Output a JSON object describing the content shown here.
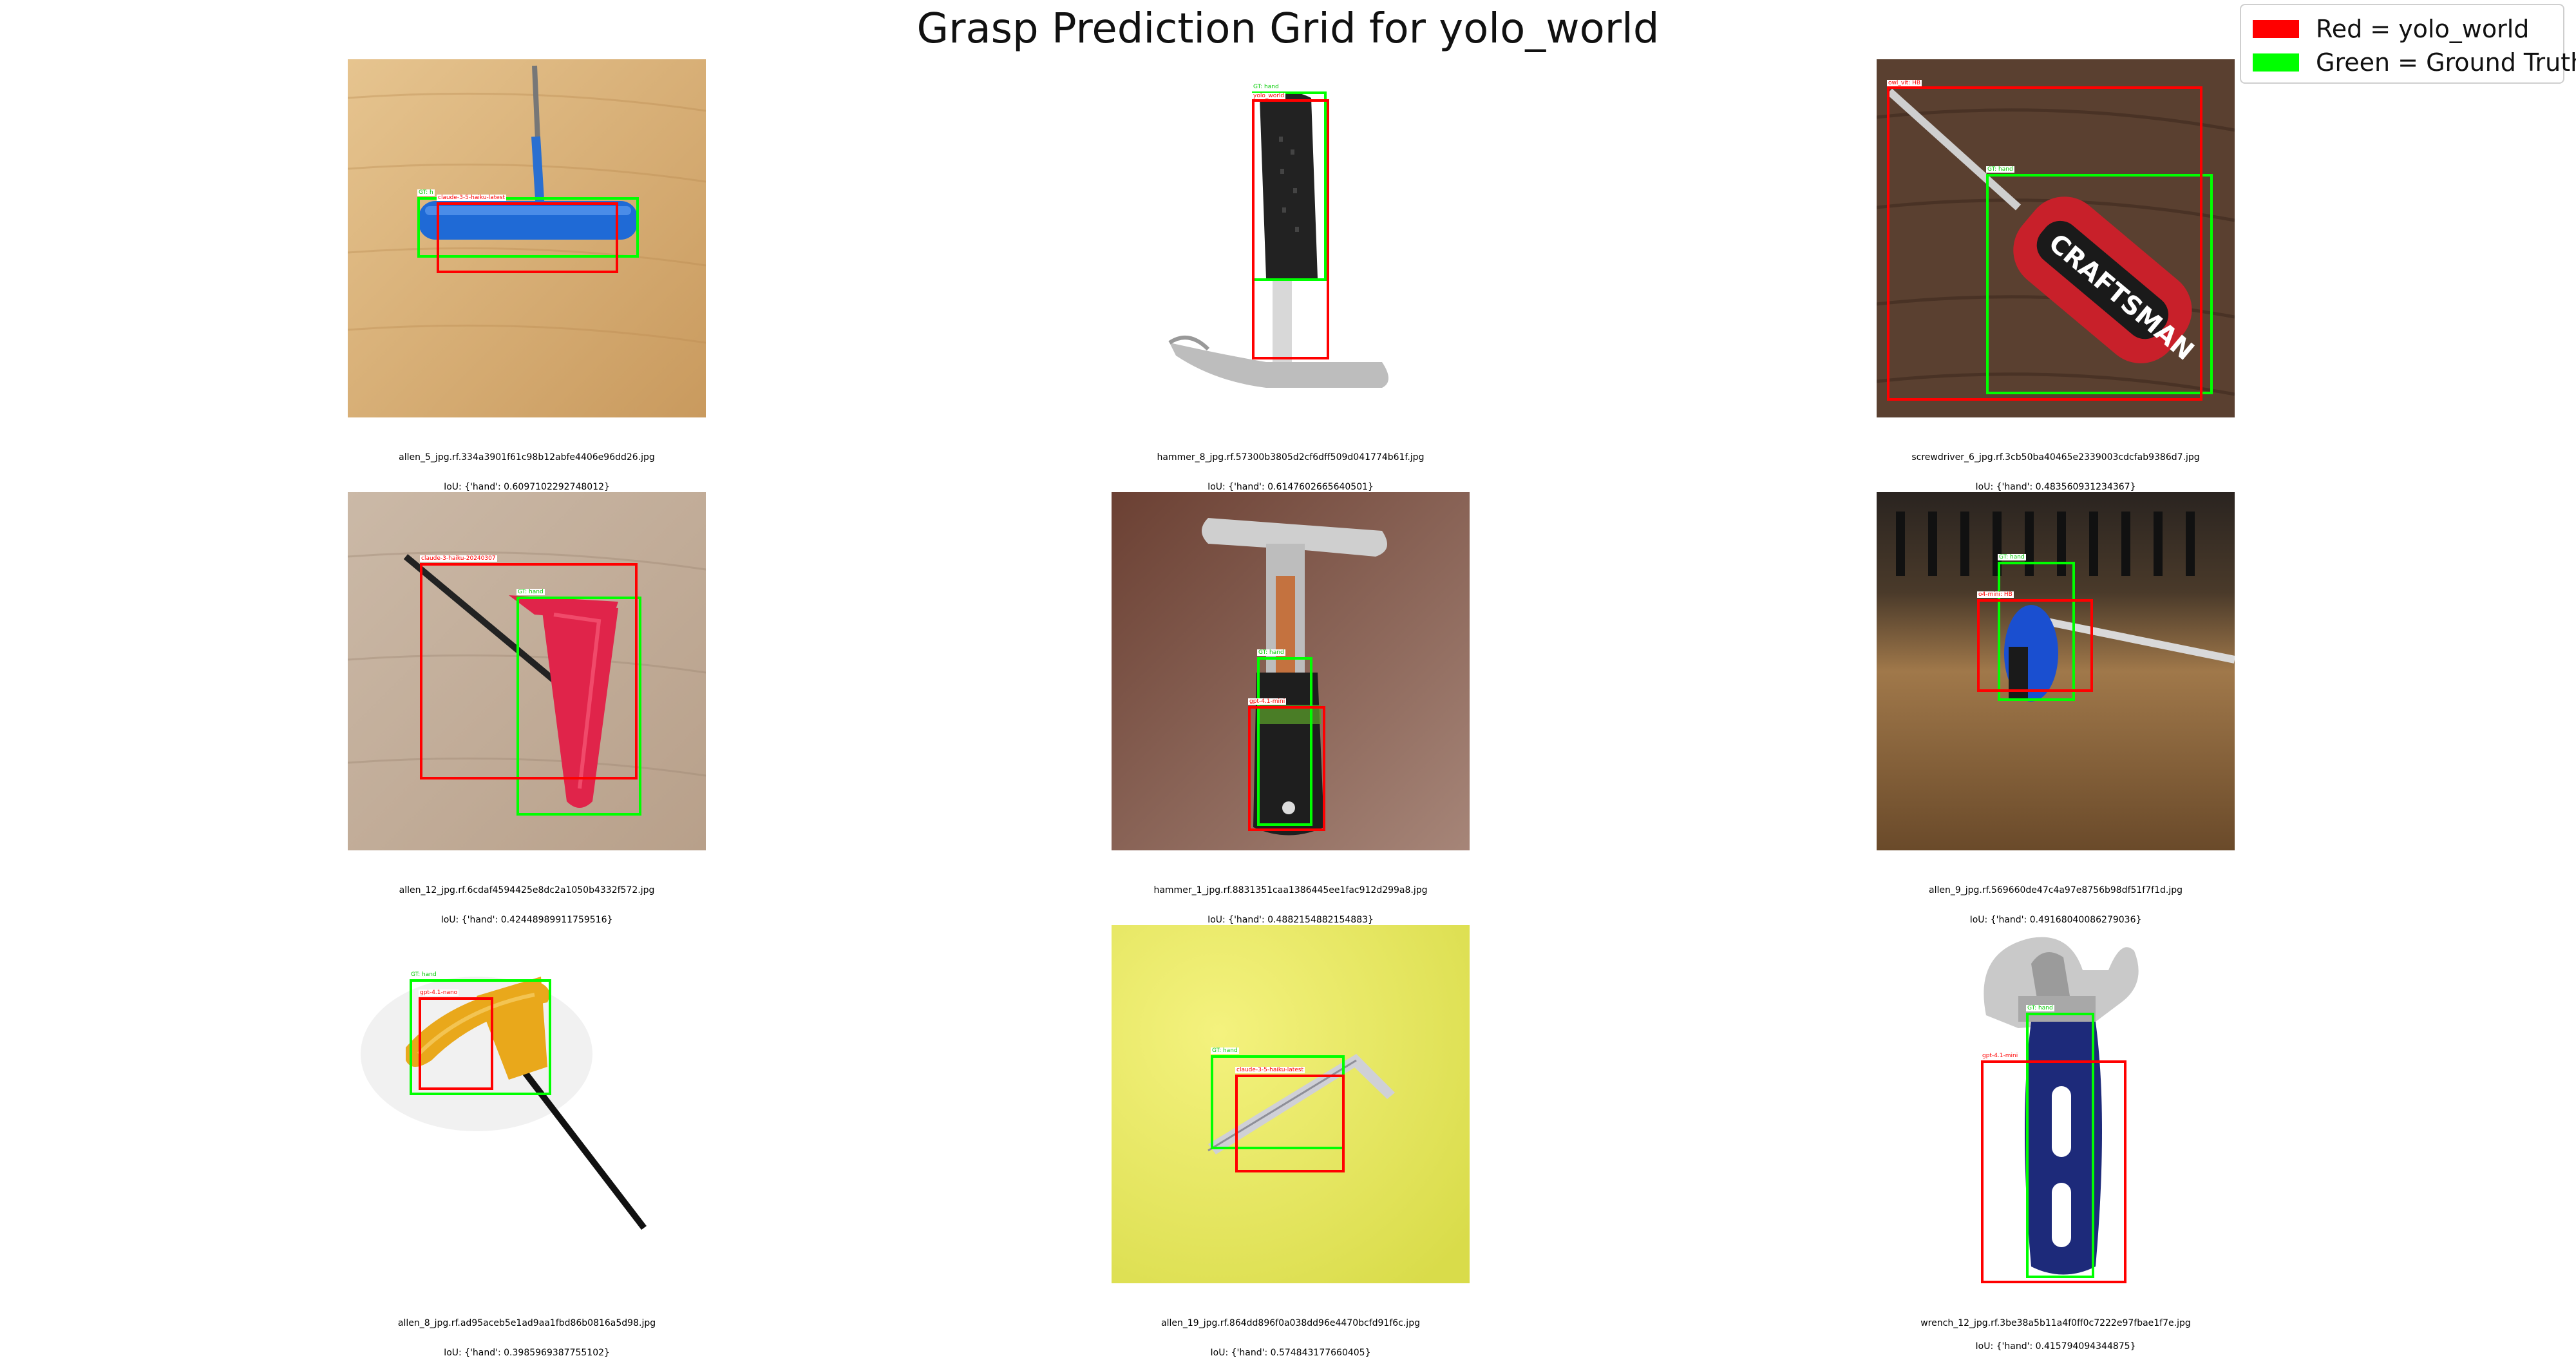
{
  "title": "Grasp Prediction Grid for yolo_world",
  "legend": [
    {
      "label": "Red = yolo_world",
      "color": "#ff0000"
    },
    {
      "label": "Green = Ground Truth",
      "color": "#00ff00"
    }
  ],
  "colors": {
    "prediction": "#ff0000",
    "ground_truth": "#00ff00"
  },
  "panels": [
    {
      "filename": "allen_5_jpg.rf.334a3901f61c98b12abfe4406e96dd26.jpg",
      "iou": "IoU: {'hand': 0.6097102292748012}",
      "gt_tag": "GT: h",
      "pred_tag": "claude-3-5-haiku-latest",
      "scene": "allen key on wooden table"
    },
    {
      "filename": "hammer_8_jpg.rf.57300b3805d2cf6dff509d041774b61f.jpg",
      "iou": "IoU: {'hand': 0.6147602665640501}",
      "gt_tag": "GT: hand",
      "pred_tag": "yolo_world",
      "scene": "hammer on white background"
    },
    {
      "filename": "screwdriver_6_jpg.rf.3cb50ba40465e2339003cdcfab9386d7.jpg",
      "iou": "IoU: {'hand': 0.483560931234367}",
      "gt_tag": "GT: hand",
      "pred_tag": "owl_vit: HB",
      "scene": "Craftsman screwdriver on wood",
      "brand_text": "CRAFTSMAN"
    },
    {
      "filename": "allen_12_jpg.rf.6cdaf4594425e8dc2a1050b4332f572.jpg",
      "iou": "IoU: {'hand': 0.42448989911759516}",
      "gt_tag": "GT: hand",
      "pred_tag": "claude-3-haiku-20240307",
      "scene": "red T-handle allen key"
    },
    {
      "filename": "hammer_1_jpg.rf.8831351caa1386445ee1fac912d299a8.jpg",
      "iou": "IoU: {'hand': 0.4882154882154883}",
      "gt_tag": "GT: hand",
      "pred_tag": "gpt-4.1-mini",
      "scene": "hammer on brown background"
    },
    {
      "filename": "allen_9_jpg.rf.569660de47c4a97e8756b98df51f7f1d.jpg",
      "iou": "IoU: {'hand': 0.49168040086279036}",
      "gt_tag": "GT: hand",
      "pred_tag": "o4-mini: HB",
      "scene": "blue allen key on bench"
    },
    {
      "filename": "allen_8_jpg.rf.ad95aceb5e1ad9aa1fbd86b0816a5d98.jpg",
      "iou": "IoU: {'hand': 0.3985969387755102}",
      "gt_tag": "GT: hand",
      "pred_tag": "gpt-4.1-nano",
      "scene": "yellow T-handle allen key"
    },
    {
      "filename": "allen_19_jpg.rf.864dd896f0a038dd96e4470bcfd91f6c.jpg",
      "iou": "IoU: {'hand': 0.574843177660405}",
      "gt_tag": "GT: hand",
      "pred_tag": "claude-3-5-haiku-latest",
      "scene": "allen key on yellow"
    },
    {
      "filename": "wrench_12_jpg.rf.3be38a5b11a4f0ff0c7222e97fbae1f7e.jpg",
      "iou": "IoU: {'hand': 0.415794094344875}",
      "gt_tag": "GT: hand",
      "pred_tag": "gpt-4.1-mini",
      "scene": "adjustable wrench"
    }
  ]
}
